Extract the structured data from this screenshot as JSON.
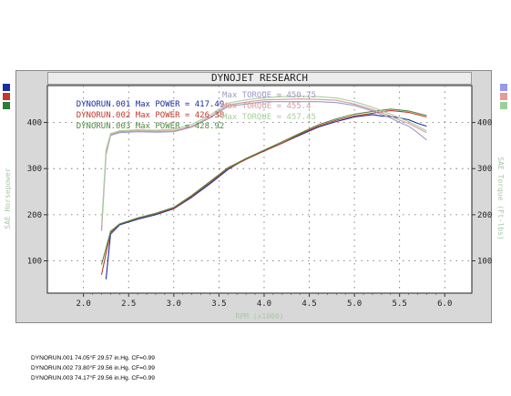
{
  "chart_data": {
    "type": "line",
    "title": "DYNOJET RESEARCH",
    "xlabel": "RPM (x1000)",
    "ylabel_left": "SAE Horsepower",
    "ylabel_right": "SAE Torque (Ft-lbs)",
    "xlim": [
      1.6,
      6.3
    ],
    "ylim": [
      30,
      480
    ],
    "x_ticks": [
      "2.0",
      "2.5",
      "3.0",
      "3.5",
      "4.0",
      "4.5",
      "5.0",
      "5.5",
      "6.0"
    ],
    "y_ticks_left": [
      "100",
      "200",
      "300",
      "400"
    ],
    "y_ticks_right": [
      "100",
      "200",
      "300",
      "400"
    ],
    "grid": true,
    "series": [
      {
        "name": "DYNORUN.001",
        "metric": "power",
        "color": "#1a2ea0",
        "x": [
          2.25,
          2.3,
          2.4,
          2.6,
          2.8,
          3.0,
          3.2,
          3.4,
          3.6,
          3.8,
          4.0,
          4.2,
          4.4,
          4.6,
          4.8,
          5.0,
          5.2,
          5.3,
          5.4,
          5.5,
          5.6,
          5.7,
          5.8
        ],
        "y": [
          60,
          158,
          178,
          190,
          200,
          213,
          238,
          267,
          298,
          322,
          338,
          355,
          373,
          390,
          402,
          412,
          417,
          414,
          413,
          410,
          406,
          398,
          392
        ]
      },
      {
        "name": "DYNORUN.002",
        "metric": "power",
        "color": "#c0392b",
        "x": [
          2.2,
          2.3,
          2.4,
          2.6,
          2.8,
          3.0,
          3.2,
          3.4,
          3.6,
          3.8,
          4.0,
          4.2,
          4.4,
          4.6,
          4.8,
          5.0,
          5.2,
          5.4,
          5.6,
          5.8
        ],
        "y": [
          70,
          162,
          180,
          192,
          202,
          214,
          240,
          270,
          300,
          320,
          338,
          355,
          375,
          392,
          405,
          414,
          420,
          426,
          422,
          412
        ]
      },
      {
        "name": "DYNORUN.003",
        "metric": "power",
        "color": "#4f8a3c",
        "x": [
          2.2,
          2.3,
          2.4,
          2.6,
          2.8,
          3.0,
          3.2,
          3.4,
          3.6,
          3.8,
          4.0,
          4.2,
          4.4,
          4.6,
          4.8,
          5.0,
          5.2,
          5.4,
          5.6,
          5.8
        ],
        "y": [
          92,
          164,
          180,
          193,
          203,
          216,
          242,
          272,
          302,
          322,
          340,
          358,
          377,
          395,
          408,
          418,
          424,
          429,
          425,
          415
        ]
      },
      {
        "name": "DYNORUN.001",
        "metric": "torque",
        "color": "#9a9ac8",
        "x": [
          2.2,
          2.25,
          2.3,
          2.4,
          2.6,
          2.8,
          3.0,
          3.2,
          3.4,
          3.6,
          3.8,
          4.0,
          4.2,
          4.4,
          4.6,
          4.8,
          5.0,
          5.2,
          5.4,
          5.5,
          5.6,
          5.7,
          5.8
        ],
        "y": [
          165,
          330,
          372,
          378,
          380,
          379,
          380,
          390,
          410,
          435,
          440,
          445,
          445,
          445,
          445,
          443,
          437,
          425,
          410,
          400,
          392,
          378,
          362
        ]
      },
      {
        "name": "DYNORUN.002",
        "metric": "torque",
        "color": "#d89a9a",
        "x": [
          2.2,
          2.25,
          2.3,
          2.4,
          2.6,
          2.8,
          3.0,
          3.2,
          3.4,
          3.6,
          3.8,
          4.0,
          4.2,
          4.4,
          4.6,
          4.8,
          5.0,
          5.2,
          5.4,
          5.5,
          5.6,
          5.7,
          5.8
        ],
        "y": [
          168,
          335,
          374,
          380,
          382,
          381,
          382,
          392,
          412,
          438,
          444,
          449,
          450,
          451,
          450,
          448,
          440,
          428,
          414,
          405,
          398,
          388,
          378
        ]
      },
      {
        "name": "DYNORUN.003",
        "metric": "torque",
        "color": "#a8cfa0",
        "x": [
          2.2,
          2.25,
          2.3,
          2.4,
          2.6,
          2.8,
          3.0,
          3.2,
          3.4,
          3.6,
          3.8,
          4.0,
          4.2,
          4.4,
          4.6,
          4.8,
          5.0,
          5.2,
          5.4,
          5.5,
          5.6,
          5.7,
          5.8
        ],
        "y": [
          178,
          340,
          376,
          382,
          384,
          383,
          385,
          396,
          416,
          442,
          449,
          454,
          456,
          457,
          456,
          453,
          445,
          433,
          418,
          410,
          402,
          392,
          382
        ]
      }
    ]
  },
  "legend": [
    {
      "run": "DYNORUN.001",
      "power_text": " Max POWER = 417.49",
      "torque_text": "Max TORQUE = 450.75",
      "color": "#1a2ea0",
      "torque_color": "#9a9ac8"
    },
    {
      "run": "DYNORUN.002",
      "power_text": " Max POWER = 426.38",
      "torque_text": "Max TORQUE = 455.4",
      "color": "#c0392b",
      "torque_color": "#d89a9a"
    },
    {
      "run": "DYNORUN.003",
      "power_text": " Max POWER = 428.92",
      "torque_text": "Max TORQUE = 457.45",
      "color": "#4f8a3c",
      "torque_color": "#a8cfa0"
    }
  ],
  "weather": [
    "DYNORUN.001 74.05°F 29.57 in.Hg. CF=0.99",
    "DYNORUN.002 73.80°F 29.56 in.Hg. CF=0.99",
    "DYNORUN.003 74.17°F 29.56 in.Hg. CF=0.99"
  ],
  "colors": {
    "left_markers": [
      "#1a2ea0",
      "#c0392b",
      "#2e7d32"
    ],
    "right_markers": [
      "#9a9ae8",
      "#e89a9a",
      "#9ad09a"
    ]
  }
}
